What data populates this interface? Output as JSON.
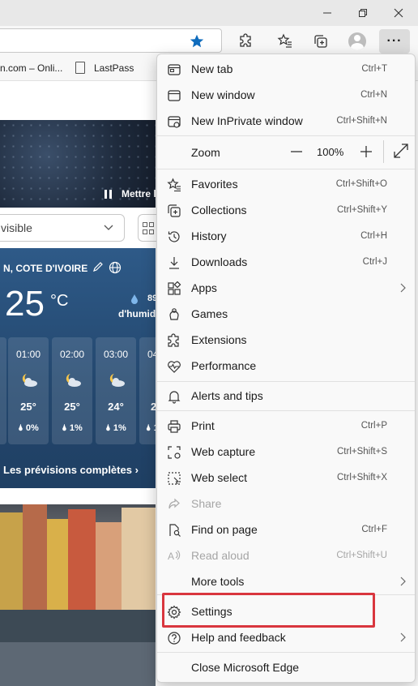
{
  "favorites_bar": {
    "item1": "n.com – Onli...",
    "item2": "LastPass"
  },
  "page": {
    "pause_label": "Mettre l",
    "select_value": "visible",
    "weather": {
      "city": "N, COTE D'IVOIRE",
      "temperature": "25",
      "unit": "°C",
      "humidity_value": "89",
      "humidity_label": "d'humidi",
      "hours": [
        {
          "time": "",
          "temp": "",
          "precip": ""
        },
        {
          "time": "01:00",
          "temp": "25°",
          "precip": "0%"
        },
        {
          "time": "02:00",
          "temp": "25°",
          "precip": "1%"
        },
        {
          "time": "03:00",
          "temp": "24°",
          "precip": "1%"
        },
        {
          "time": "04",
          "temp": "2",
          "precip": "1"
        }
      ],
      "forecast_link": "Les prévisions complètes"
    }
  },
  "menu": {
    "items": [
      {
        "label": "New tab",
        "shortcut": "Ctrl+T"
      },
      {
        "label": "New window",
        "shortcut": "Ctrl+N"
      },
      {
        "label": "New InPrivate window",
        "shortcut": "Ctrl+Shift+N"
      },
      {
        "label": "Favorites",
        "shortcut": "Ctrl+Shift+O"
      },
      {
        "label": "Collections",
        "shortcut": "Ctrl+Shift+Y"
      },
      {
        "label": "History",
        "shortcut": "Ctrl+H"
      },
      {
        "label": "Downloads",
        "shortcut": "Ctrl+J"
      },
      {
        "label": "Apps",
        "shortcut": ""
      },
      {
        "label": "Games",
        "shortcut": ""
      },
      {
        "label": "Extensions",
        "shortcut": ""
      },
      {
        "label": "Performance",
        "shortcut": ""
      },
      {
        "label": "Alerts and tips",
        "shortcut": ""
      },
      {
        "label": "Print",
        "shortcut": "Ctrl+P"
      },
      {
        "label": "Web capture",
        "shortcut": "Ctrl+Shift+S"
      },
      {
        "label": "Web select",
        "shortcut": "Ctrl+Shift+X"
      },
      {
        "label": "Share",
        "shortcut": ""
      },
      {
        "label": "Find on page",
        "shortcut": "Ctrl+F"
      },
      {
        "label": "Read aloud",
        "shortcut": "Ctrl+Shift+U"
      },
      {
        "label": "More tools",
        "shortcut": ""
      },
      {
        "label": "Settings",
        "shortcut": ""
      },
      {
        "label": "Help and feedback",
        "shortcut": ""
      },
      {
        "label": "Close Microsoft Edge",
        "shortcut": ""
      }
    ],
    "zoom": {
      "label": "Zoom",
      "value": "100%",
      "minus": "—",
      "plus": "+"
    }
  },
  "colors": {
    "highlight": "#d9363e",
    "accent_blue": "#0f6cbd"
  }
}
